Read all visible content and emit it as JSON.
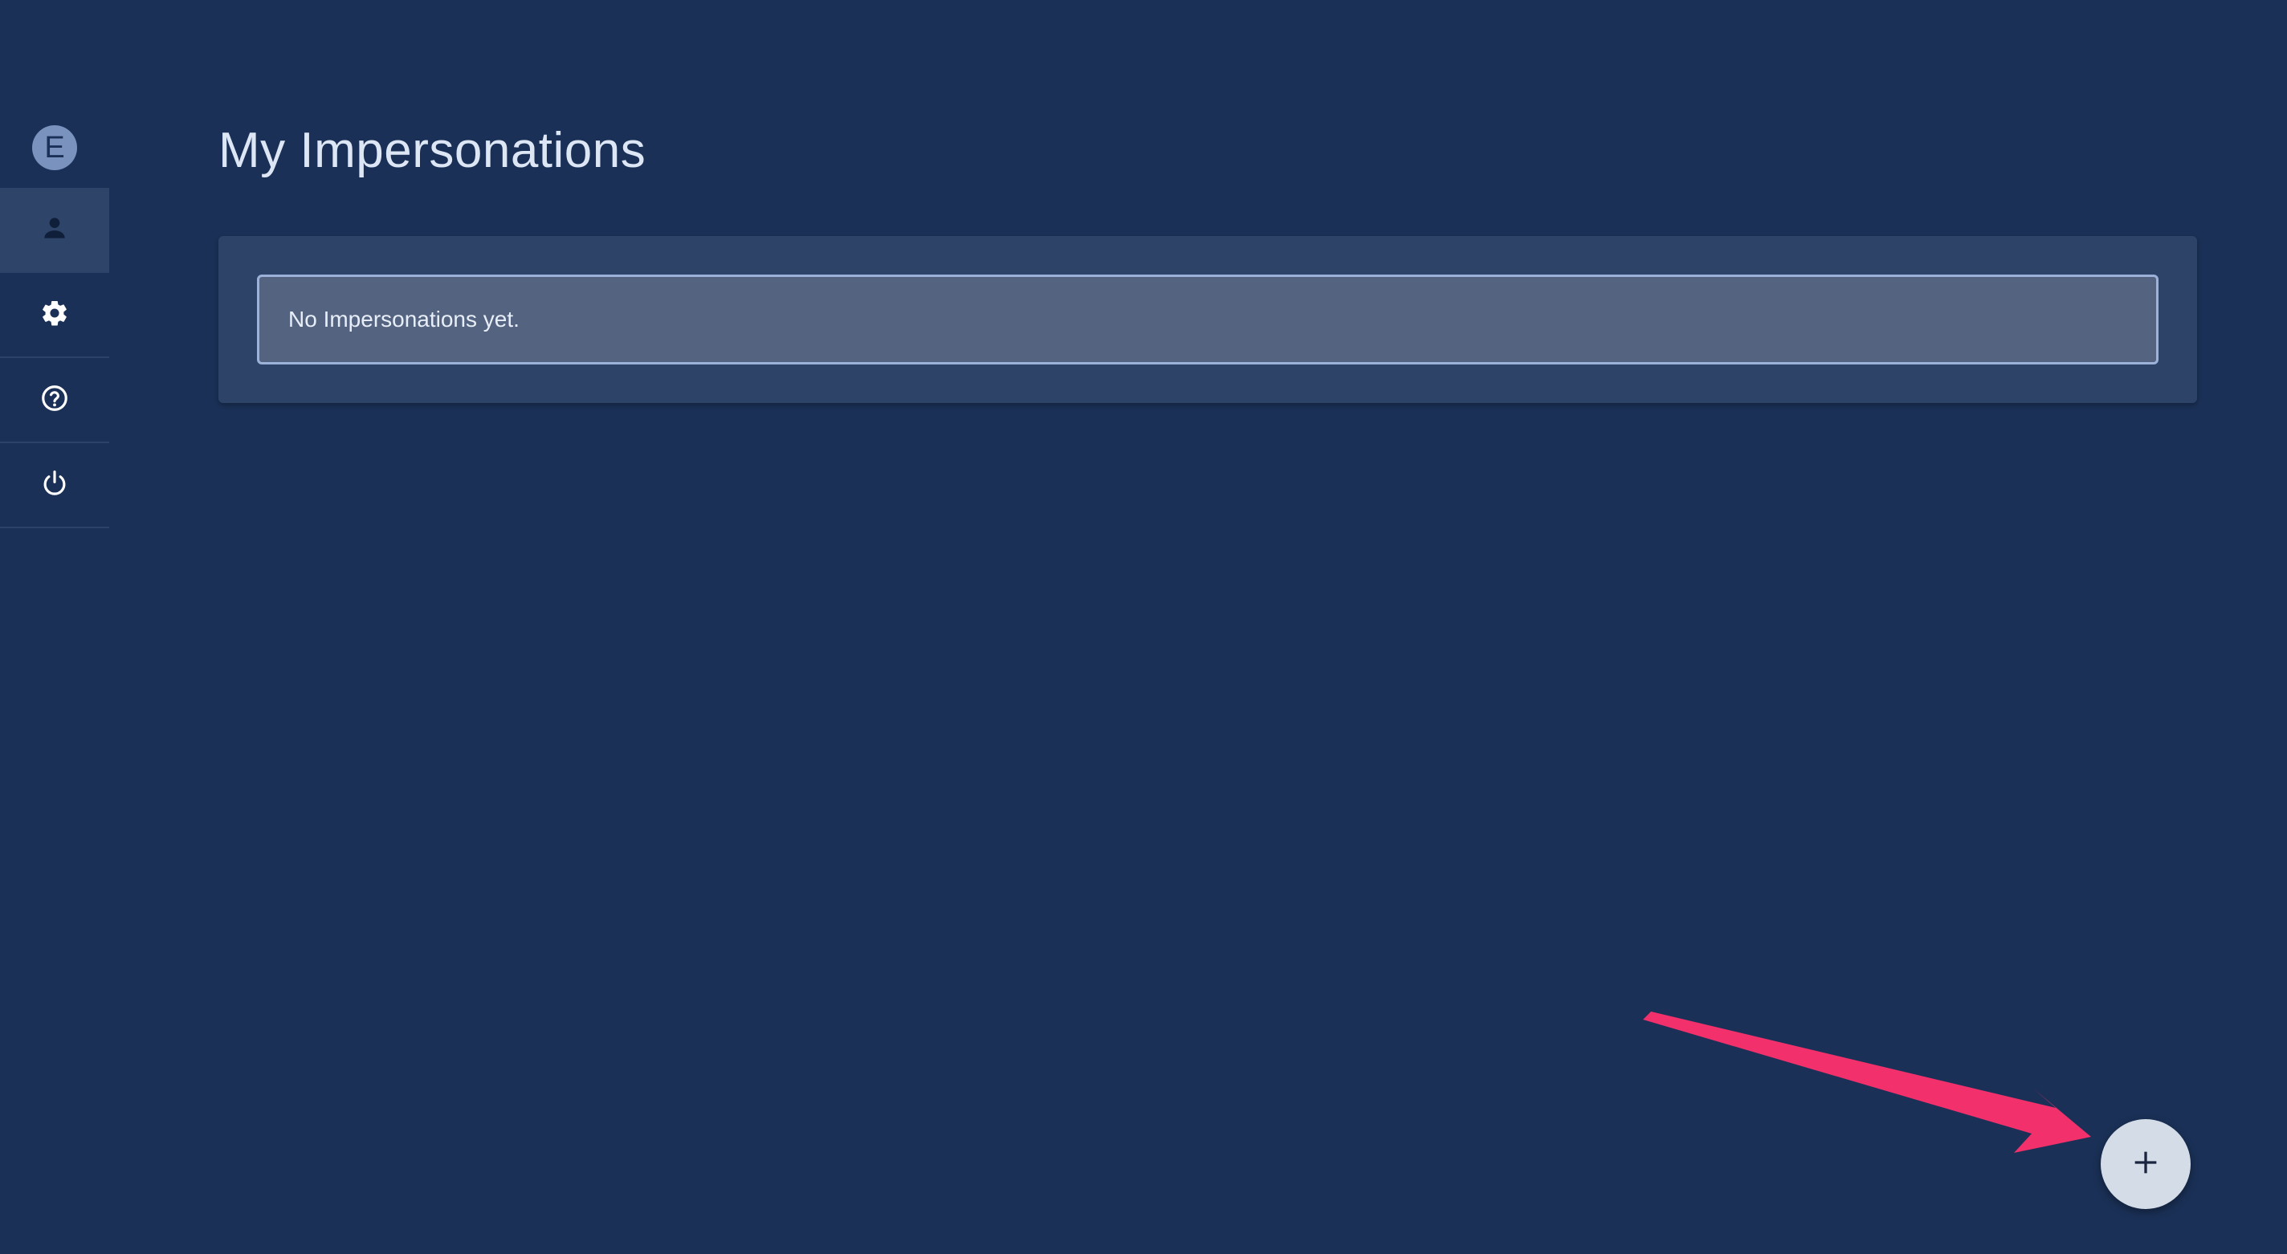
{
  "sidebar": {
    "avatar_initial": "E",
    "items": [
      {
        "icon": "person-icon",
        "active": true
      },
      {
        "icon": "gear-icon",
        "active": false
      },
      {
        "icon": "help-circle-icon",
        "active": false
      },
      {
        "icon": "power-icon",
        "active": false
      }
    ]
  },
  "main": {
    "title": "My Impersonations",
    "empty_message": "No Impersonations yet."
  },
  "fab": {
    "icon": "plus-icon"
  },
  "colors": {
    "background": "#1a3056",
    "card": "#2d4468",
    "empty_box": "#546480",
    "empty_border": "#9cb2d8",
    "fab": "#d4dce8",
    "annotation_arrow": "#f2306b"
  }
}
